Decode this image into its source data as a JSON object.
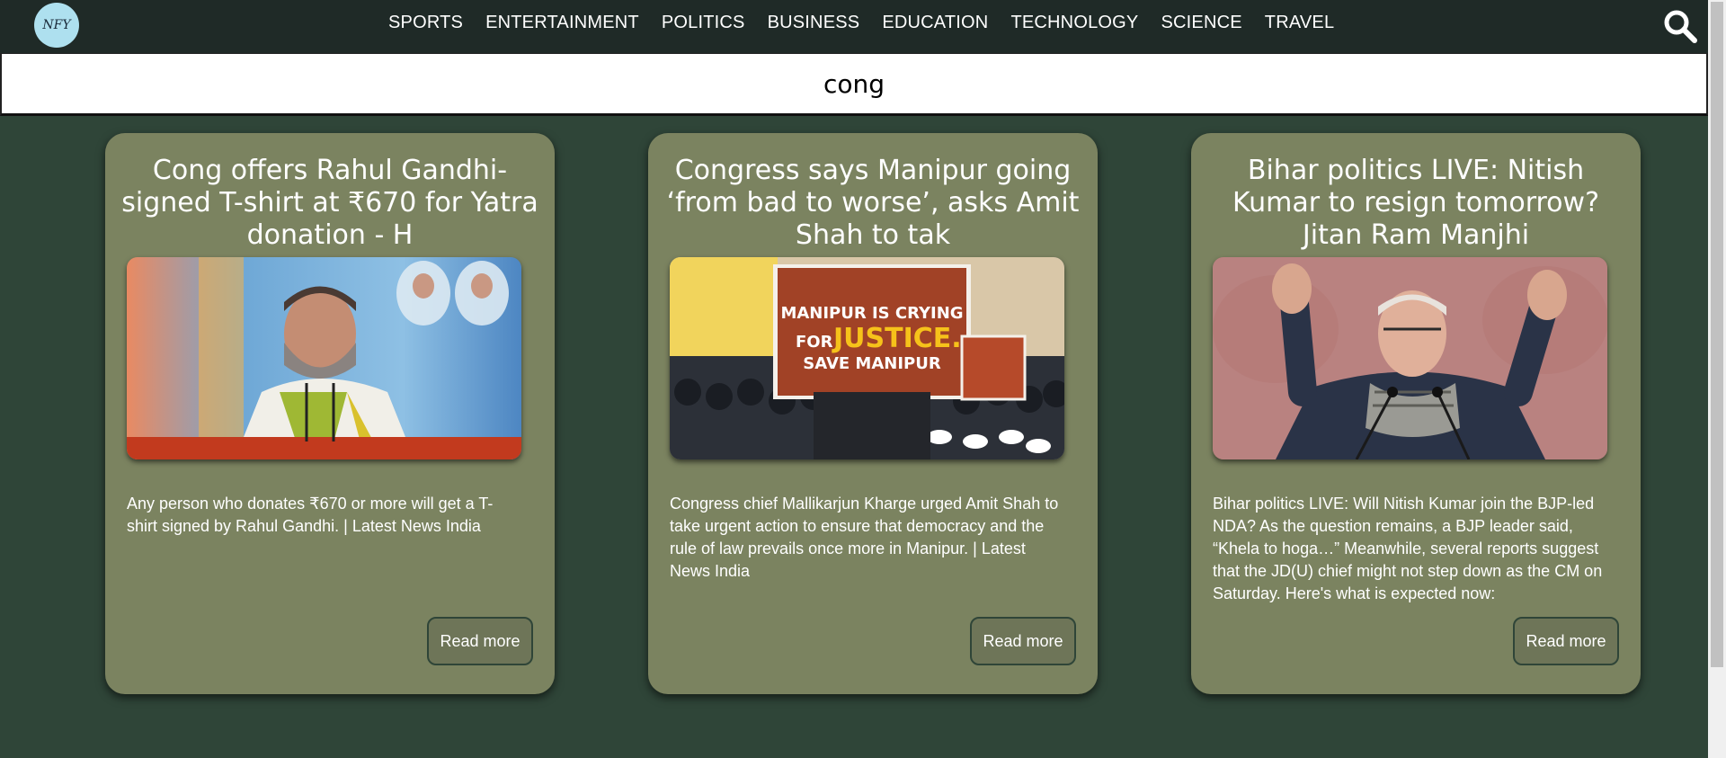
{
  "header": {
    "logo_text": "NFY",
    "nav": [
      "SPORTS",
      "ENTERTAINMENT",
      "POLITICS",
      "BUSINESS",
      "EDUCATION",
      "TECHNOLOGY",
      "SCIENCE",
      "TRAVEL"
    ]
  },
  "search": {
    "value": "cong"
  },
  "articles": [
    {
      "title": "Cong offers Rahul Gandhi-signed T-shirt at ₹670 for Yatra donation - H",
      "description": "Any person who donates ₹670 or more will get a T-shirt signed by Rahul Gandhi. | Latest News India",
      "button": "Read more"
    },
    {
      "title": "Congress says Manipur going ‘from bad to worse’, asks Amit Shah to tak",
      "description": "Congress chief Mallikarjun Kharge urged Amit Shah to take urgent action to ensure that democracy and the rule of law prevails once more in Manipur. | Latest News India",
      "button": "Read more",
      "image_text": {
        "poster_line1": "MANIPUR IS CRYING",
        "poster_line2": "FOR",
        "poster_line3": "JUSTICE.",
        "poster_line4": "SAVE MANIPUR"
      }
    },
    {
      "title": "Bihar politics LIVE: Nitish Kumar to resign tomorrow? Jitan Ram Manjhi",
      "description": "Bihar politics LIVE: Will Nitish Kumar join the BJP-led NDA? As the question remains, a BJP leader said, “Khela to hoga…” Meanwhile, several reports suggest that the JD(U) chief might not step down as the CM on Saturday. Here's what is expected now:",
      "button": "Read more"
    }
  ],
  "colors": {
    "header_bg": "#1f2a27",
    "page_bg": "#2f4538",
    "card_bg": "#7b8360",
    "logo_bg": "#aee0ef"
  }
}
